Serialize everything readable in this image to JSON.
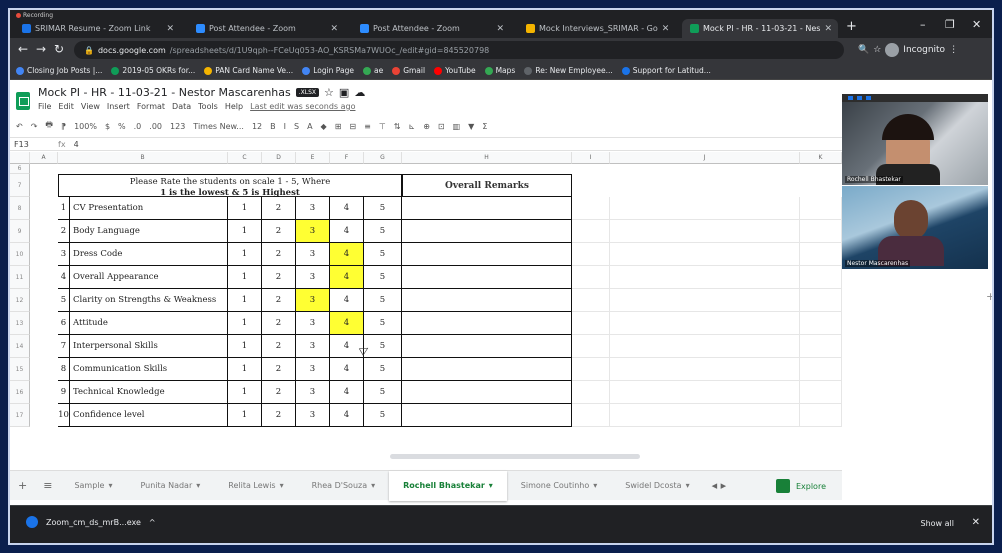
{
  "recording": {
    "label": "Recording"
  },
  "browser": {
    "tabs": [
      {
        "title": "SRIMAR Resume - Zoom Link",
        "icon_color": "#1a73e8",
        "active": false
      },
      {
        "title": "Post Attendee - Zoom",
        "icon_color": "#2d8cff",
        "active": false
      },
      {
        "title": "Post Attendee - Zoom",
        "icon_color": "#2d8cff",
        "active": false
      },
      {
        "title": "Mock Interviews_SRIMAR - Go",
        "icon_color": "#f4b400",
        "active": false
      },
      {
        "title": "Mock PI - HR - 11-03-21 - Nes",
        "icon_color": "#0f9d58",
        "active": true
      }
    ],
    "new_tab": "+",
    "window_controls": [
      "–",
      "❐",
      "✕"
    ],
    "url_domain": "docs.google.com",
    "url_path": "/spreadsheets/d/1U9qph--FCeUq053-AO_KSRSMa7WUOc_/edit#gid=845520798",
    "incognito_label": "Incognito",
    "bookmarks": [
      {
        "label": "Closing Job Posts |...",
        "color": "#4285f4"
      },
      {
        "label": "2019-05 OKRs for...",
        "color": "#0f9d58"
      },
      {
        "label": "PAN Card Name Ve...",
        "color": "#f4b400"
      },
      {
        "label": "Login Page",
        "color": "#4285f4"
      },
      {
        "label": "ae",
        "color": "#34a853"
      },
      {
        "label": "Gmail",
        "color": "#ea4335"
      },
      {
        "label": "YouTube",
        "color": "#ff0000"
      },
      {
        "label": "Maps",
        "color": "#34a853"
      },
      {
        "label": "Re: New Employee...",
        "color": "#5f6368"
      },
      {
        "label": "Support for Latitud...",
        "color": "#1a73e8"
      }
    ]
  },
  "sheet": {
    "title": "Mock PI - HR - 11-03-21 - Nestor Mascarenhas",
    "badge": ".XLSX",
    "menus": [
      "File",
      "Edit",
      "View",
      "Insert",
      "Format",
      "Data",
      "Tools",
      "Help"
    ],
    "last_edit": "Last edit was seconds ago",
    "toolbar": [
      "↶",
      "↷",
      "🖶",
      "⁋",
      "100%",
      "$",
      "%",
      ".0",
      ".00",
      "123",
      "Times New...",
      "12",
      "B",
      "I",
      "S",
      "A",
      "◆",
      "⊞",
      "⊟",
      "≡",
      "⊤",
      "⇅",
      "⊾",
      "⊕",
      "⊡",
      "▥",
      "▼",
      "Σ"
    ],
    "cell_ref": "F13",
    "fx_label": "fx",
    "formula_value": "4",
    "columns": [
      "A",
      "B",
      "C",
      "D",
      "E",
      "F",
      "G",
      "H",
      "I",
      "J",
      "K"
    ],
    "row_numbers": [
      "6",
      "7",
      "8",
      "9",
      "10",
      "11",
      "12",
      "13",
      "14",
      "15",
      "16",
      "17"
    ],
    "rating_header_line1": "Please Rate the students on scale 1 - 5, Where",
    "rating_header_line2": "1 is the lowest & 5 is Highest",
    "remarks_header": "Overall Remarks",
    "scale": [
      "1",
      "2",
      "3",
      "4",
      "5"
    ],
    "criteria": [
      {
        "num": "1",
        "label": "CV Presentation",
        "selected": null
      },
      {
        "num": "2",
        "label": "Body Language",
        "selected": 3
      },
      {
        "num": "3",
        "label": "Dress Code",
        "selected": 4
      },
      {
        "num": "4",
        "label": "Overall Appearance",
        "selected": 4
      },
      {
        "num": "5",
        "label": "Clarity on Strengths & Weakness",
        "selected": 3
      },
      {
        "num": "6",
        "label": "Attitude",
        "selected": 4
      },
      {
        "num": "7",
        "label": "Interpersonal Skills",
        "selected": null
      },
      {
        "num": "8",
        "label": "Communication Skills",
        "selected": null
      },
      {
        "num": "9",
        "label": "Technical Knowledge",
        "selected": null
      },
      {
        "num": "10",
        "label": "Confidence level",
        "selected": null
      }
    ],
    "highlight_color": "#ffff33",
    "sheet_tabs": [
      "Sample",
      "Punita Nadar",
      "Relita Lewis",
      "Rhea D'Souza",
      "Rochell Bhastekar",
      "Simone Coutinho",
      "Swidel Dcosta"
    ],
    "active_sheet_tab": "Rochell Bhastekar",
    "explore_label": "Explore"
  },
  "zoom": {
    "participants": [
      {
        "name": "Rochell Bhastekar"
      },
      {
        "name": "Nestor Mascarenhas"
      }
    ]
  },
  "download": {
    "filename": "Zoom_cm_ds_mrB...exe",
    "show_all": "Show all",
    "close": "✕"
  }
}
